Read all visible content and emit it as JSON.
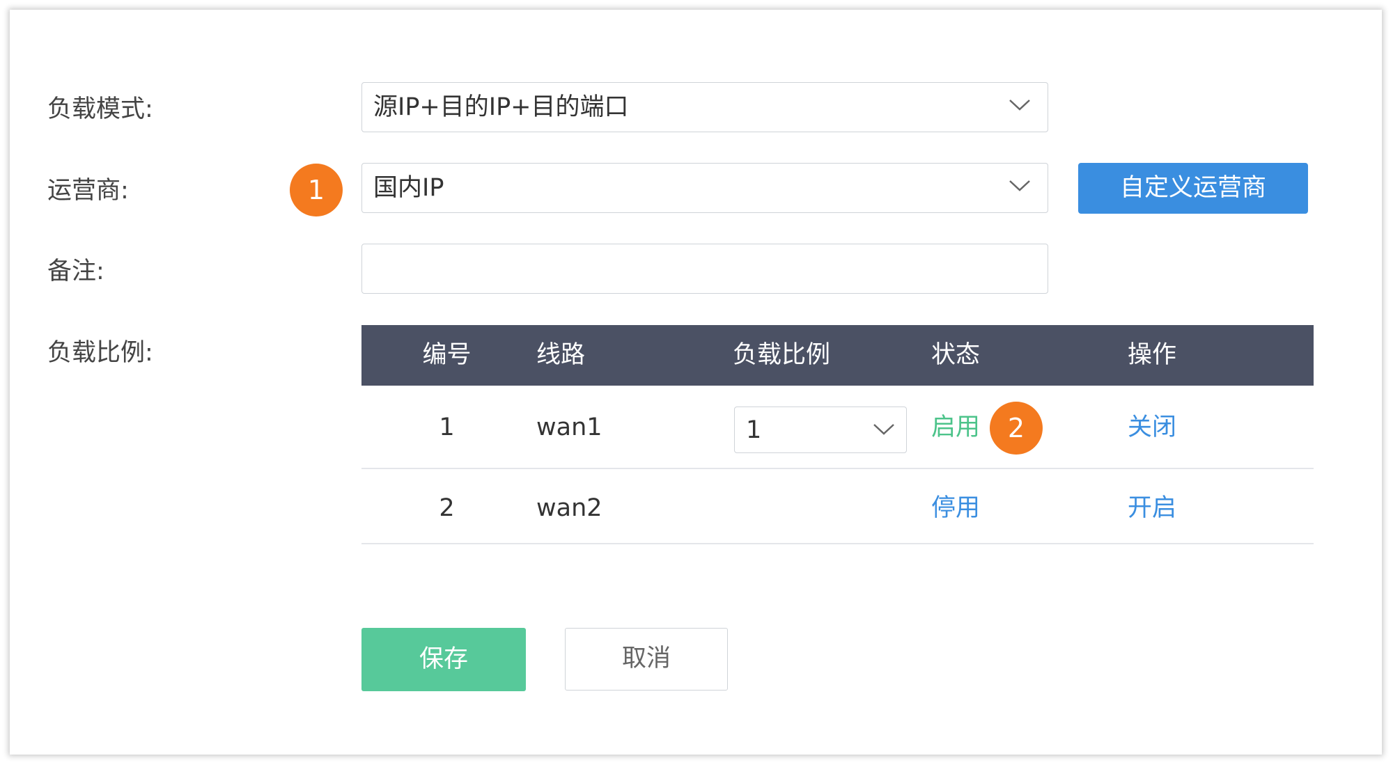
{
  "form": {
    "mode_label": "负载模式:",
    "mode_value": "源IP+目的IP+目的端口",
    "isp_label": "运营商:",
    "isp_value": "国内IP",
    "custom_isp_button": "自定义运营商",
    "remark_label": "备注:",
    "remark_value": "",
    "ratio_label": "负载比例:"
  },
  "badges": {
    "one": "1",
    "two": "2"
  },
  "table": {
    "headers": [
      "编号",
      "线路",
      "负载比例",
      "状态",
      "操作"
    ],
    "rows": [
      {
        "no": "1",
        "line": "wan1",
        "ratio": "1",
        "status": "启用",
        "action": "关闭"
      },
      {
        "no": "2",
        "line": "wan2",
        "ratio": "",
        "status": "停用",
        "action": "开启"
      }
    ]
  },
  "buttons": {
    "save": "保存",
    "cancel": "取消"
  },
  "colors": {
    "accent_blue": "#3a8ee0",
    "save_green": "#57c99a",
    "status_enabled_green": "#4cc38a",
    "badge_orange": "#f47a1f",
    "table_header": "#4b5164"
  },
  "icons": {
    "dropdown": "chevron-down-icon"
  }
}
